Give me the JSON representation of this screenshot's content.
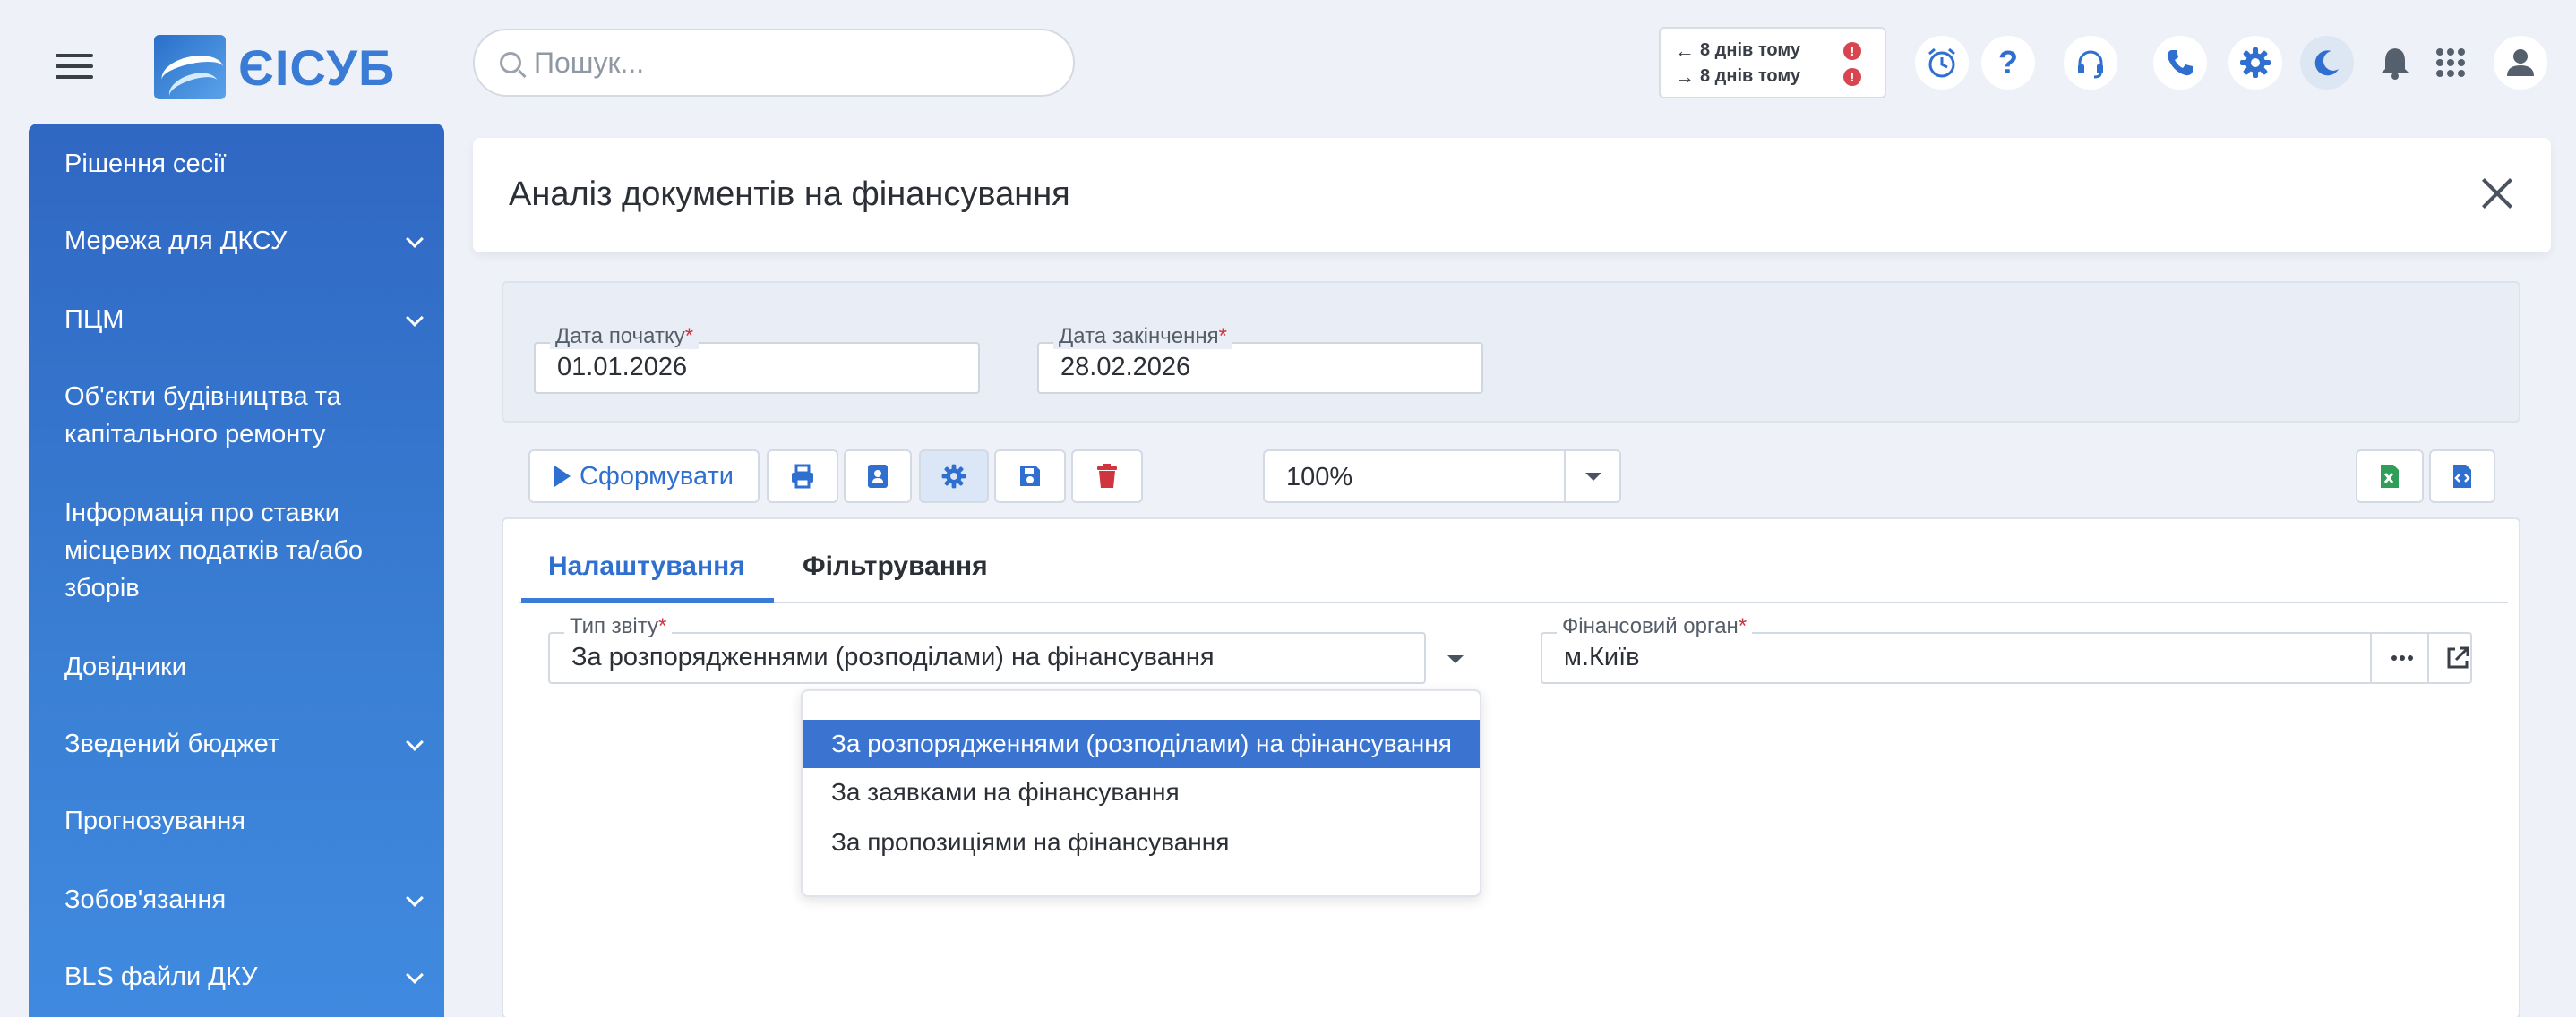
{
  "app": {
    "logo_text": "ЄІСУБ"
  },
  "search": {
    "placeholder": "Пошук..."
  },
  "sync": {
    "outgoing": "8 днів тому",
    "incoming": "8 днів тому",
    "alert_symbol": "!"
  },
  "top_icons": [
    "alarm-clock-icon",
    "help-icon",
    "headset-icon",
    "phone-icon",
    "gear-icon",
    "moon-icon",
    "bell-icon",
    "apps-grid-icon",
    "user-icon"
  ],
  "sidebar": {
    "items": [
      {
        "label": "Рішення сесії",
        "expandable": false
      },
      {
        "label": "Мережа для ДКСУ",
        "expandable": true
      },
      {
        "label": "ПЦМ",
        "expandable": true
      },
      {
        "label": "Об'єкти будівництва та капітального ремонту",
        "expandable": false
      },
      {
        "label": "Інформація про ставки місцевих податків та/або зборів",
        "expandable": false
      },
      {
        "label": "Довідники",
        "expandable": false
      },
      {
        "label": "Зведений бюджет",
        "expandable": true
      },
      {
        "label": "Прогнозування",
        "expandable": false
      },
      {
        "label": "Зобов'язання",
        "expandable": true
      },
      {
        "label": "BLS файли ДКУ",
        "expandable": true
      }
    ]
  },
  "page": {
    "title": "Аналіз документів на фінансування"
  },
  "filters": {
    "start_date_label": "Дата початку",
    "start_date_value": "01.01.2026",
    "end_date_label": "Дата закінчення",
    "end_date_value": "28.02.2026",
    "required_mark": "*"
  },
  "toolbar": {
    "generate_label": "Сформувати",
    "zoom_value": "100%"
  },
  "tabs": [
    {
      "label": "Налаштування",
      "active": true
    },
    {
      "label": "Фільтрування",
      "active": false
    }
  ],
  "settings": {
    "report_type_label": "Тип звіту",
    "report_type_value": "За розпорядженнями (розподілами) на фінансування",
    "fin_org_label": "Фінансовий орган",
    "fin_org_value": "м.Київ"
  },
  "report_type_options": [
    {
      "label": "За розпорядженнями (розподілами) на фінансування",
      "selected": true
    },
    {
      "label": "За заявками на фінансування",
      "selected": false
    },
    {
      "label": "За пропозиціями на фінансування",
      "selected": false
    }
  ],
  "colors": {
    "accent": "#3a7bd5",
    "sidebar_top": "#2f67c3",
    "sidebar_bottom": "#3f8ae0",
    "danger": "#d0343f",
    "excel": "#2e9e58"
  }
}
